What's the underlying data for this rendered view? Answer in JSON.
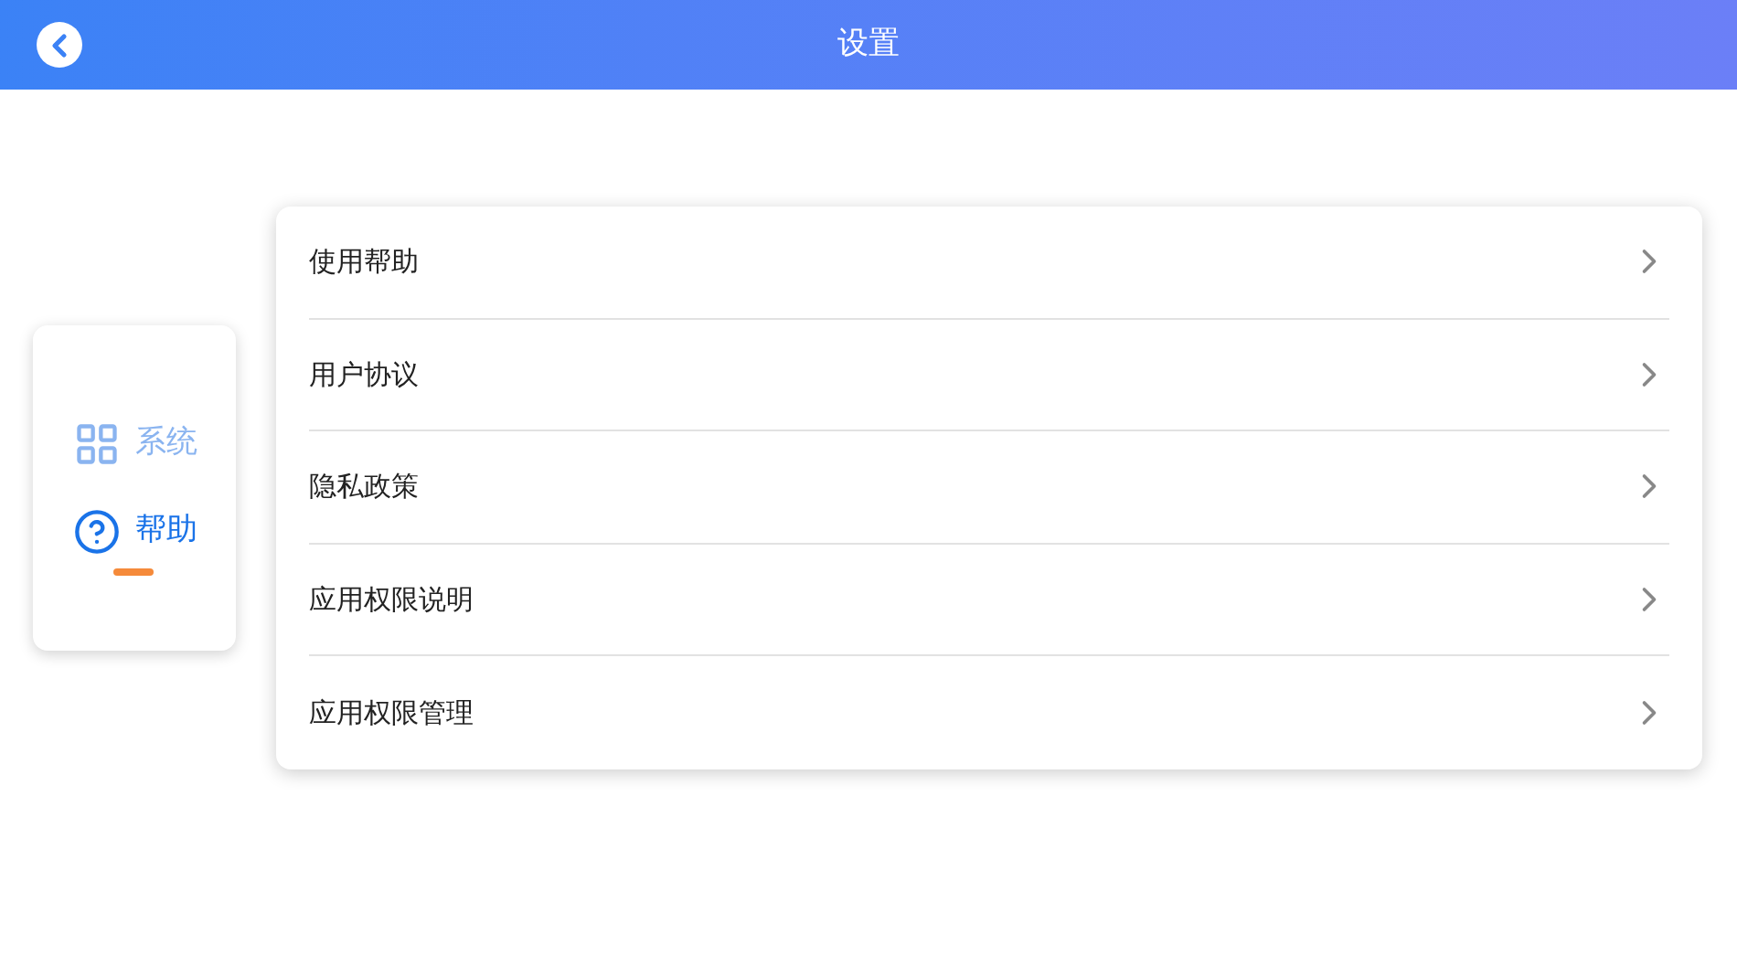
{
  "header": {
    "title": "设置"
  },
  "sidebar": {
    "items": [
      {
        "label": "系统",
        "kind": "grid",
        "selected": false
      },
      {
        "label": "帮助",
        "kind": "help",
        "selected": true
      }
    ]
  },
  "menu": {
    "items": [
      {
        "label": "使用帮助"
      },
      {
        "label": "用户协议"
      },
      {
        "label": "隐私政策"
      },
      {
        "label": "应用权限说明"
      },
      {
        "label": "应用权限管理"
      }
    ]
  }
}
